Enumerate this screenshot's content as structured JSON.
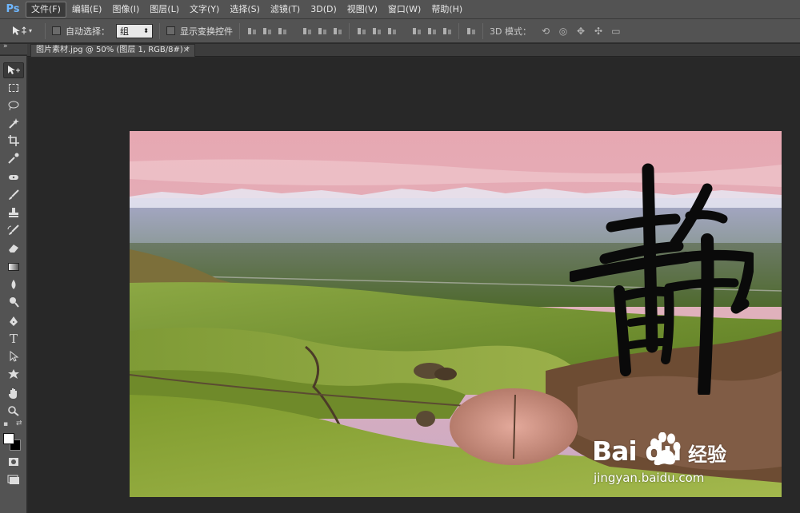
{
  "app": {
    "logo": "Ps"
  },
  "menu": [
    "文件(F)",
    "编辑(E)",
    "图像(I)",
    "图层(L)",
    "文字(Y)",
    "选择(S)",
    "滤镜(T)",
    "3D(D)",
    "视图(V)",
    "窗口(W)",
    "帮助(H)"
  ],
  "options": {
    "auto_select_label": "自动选择：",
    "auto_select_value": "组",
    "show_transform_label": "显示变换控件",
    "mode_3d_label": "3D 模式："
  },
  "document_tab": {
    "title": "图片素材.jpg @ 50% (图层 1, RGB/8#) *",
    "close": "×"
  },
  "tools": [
    "move-tool",
    "marquee-tool",
    "lasso-tool",
    "magic-wand-tool",
    "crop-tool",
    "eyedropper-tool",
    "healing-brush-tool",
    "brush-tool",
    "clone-stamp-tool",
    "history-brush-tool",
    "eraser-tool",
    "gradient-tool",
    "blur-tool",
    "dodge-tool",
    "pen-tool",
    "type-tool",
    "path-selection-tool",
    "shape-tool",
    "hand-tool",
    "zoom-tool"
  ],
  "colors": {
    "foreground": "#ffffff",
    "background": "#000000"
  },
  "canvas": {
    "overlay_glyph": "静",
    "watermark_brand": "Bai du",
    "watermark_cn": "经验",
    "watermark_url": "jingyan.baidu.com"
  }
}
